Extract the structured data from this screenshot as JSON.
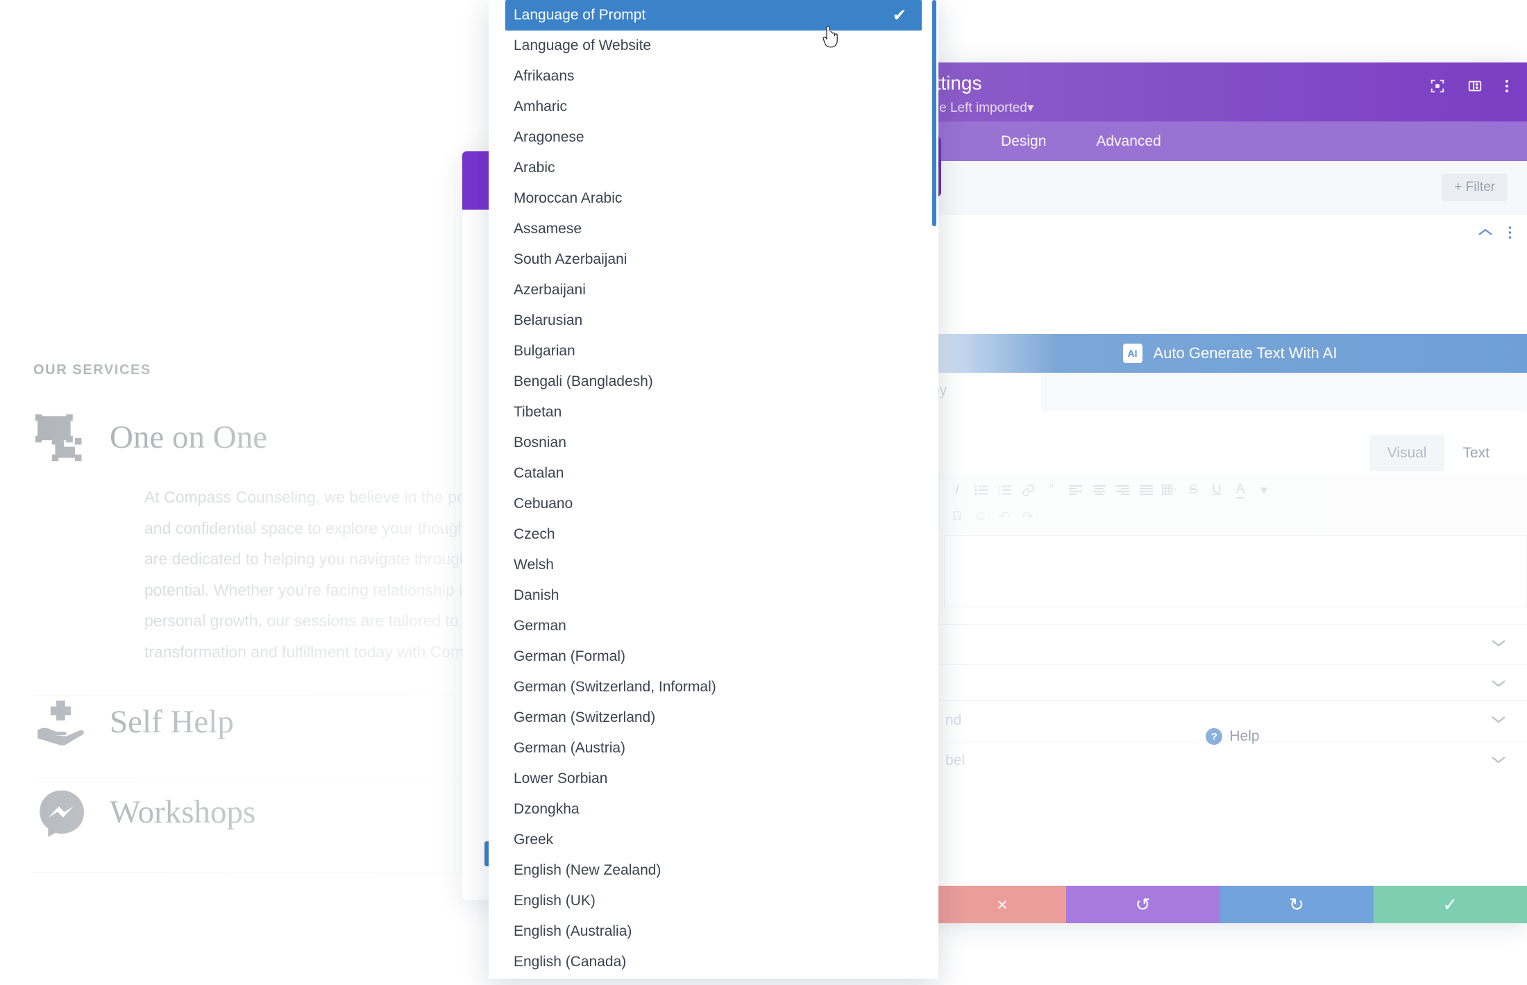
{
  "site_preview": {
    "eyebrow": "OUR SERVICES",
    "services": [
      {
        "icon": "screen-share-icon",
        "title": "One on One",
        "body": "At Compass Counseling, we believe in the power of connection. Our One-on-One sessions provide a safe and confidential space to explore your thoughts, feelings, and challenges. Our experienced counselors are dedicated to helping you navigate through life's ups and downs, empowering you to discover your true potential. Whether you're facing relationship issues, struggling with anxiety or depression, or seeking personal growth, our sessions are tailored to meet your unique needs. Start your journey toward healing, transformation and fulfillment today with Compass Counseling."
      },
      {
        "icon": "helping-hand-icon",
        "title": "Self Help",
        "body": ""
      },
      {
        "icon": "messenger-chat-icon",
        "title": "Workshops",
        "body": ""
      }
    ]
  },
  "hidden_modal": {
    "title": "",
    "primary_button": "",
    "secondary_button": ""
  },
  "divi_panel": {
    "header": {
      "title": "ettings",
      "subtitle": "age Left imported",
      "subtitle_caret": "▾",
      "icons": [
        {
          "name": "fullscreen-icon"
        },
        {
          "name": "split-view-icon"
        },
        {
          "name": "more-options-icon"
        }
      ]
    },
    "tabs": [
      {
        "label": "Design",
        "active": false
      },
      {
        "label": "Advanced",
        "active": false
      }
    ],
    "toolbar": {
      "filter_label": "Filter",
      "filter_plus": "+",
      "back_arrow": "‹"
    },
    "content": {
      "collapse_chevron": "⌃",
      "section_menu": "⋮",
      "ai_button_label": "Auto Generate Text With AI",
      "ai_badge": "AI",
      "field_label_partial": "py",
      "editor_tabs": [
        {
          "label": "Visual",
          "active": false
        },
        {
          "label": "Text",
          "active": true
        }
      ],
      "editor_toolbar_icons": [
        "italic-icon",
        "bulleted-list-icon",
        "numbered-list-icon",
        "link-icon",
        "blockquote-icon",
        "align-left-icon",
        "align-center-icon",
        "align-right-icon",
        "align-justify-icon",
        "table-icon",
        "strikethrough-icon",
        "underline-icon",
        "text-color-icon"
      ],
      "editor_toolbar_icons_row2": [
        "special-character-icon",
        "emoji-icon",
        "undo-icon",
        "redo-icon"
      ],
      "accordions": [
        {
          "label": "",
          "chevron": "⌄"
        },
        {
          "label": "",
          "chevron": "⌄"
        },
        {
          "label": "nd",
          "chevron": "⌄"
        },
        {
          "label": "bel",
          "chevron": "⌄"
        }
      ],
      "help_label": "Help",
      "help_icon": "?"
    },
    "actions": [
      {
        "name": "delete-button",
        "icon": "×",
        "color": "#eb9d9b"
      },
      {
        "name": "undo-button",
        "icon": "↺",
        "color": "#a77ae0"
      },
      {
        "name": "redo-button",
        "icon": "↻",
        "color": "#73a3dc"
      },
      {
        "name": "save-button",
        "icon": "✓",
        "color": "#7ecfb0"
      }
    ]
  },
  "language_dropdown": {
    "selected": "Language of Prompt",
    "check_glyph": "✔",
    "items": [
      "Language of Prompt",
      "Language of Website",
      "Afrikaans",
      "Amharic",
      "Aragonese",
      "Arabic",
      "Moroccan Arabic",
      "Assamese",
      "South Azerbaijani",
      "Azerbaijani",
      "Belarusian",
      "Bulgarian",
      "Bengali (Bangladesh)",
      "Tibetan",
      "Bosnian",
      "Catalan",
      "Cebuano",
      "Czech",
      "Welsh",
      "Danish",
      "German",
      "German (Formal)",
      "German (Switzerland, Informal)",
      "German (Switzerland)",
      "German (Austria)",
      "Lower Sorbian",
      "Dzongkha",
      "Greek",
      "English (New Zealand)",
      "English (UK)",
      "English (Australia)",
      "English (Canada)"
    ]
  },
  "colors": {
    "dropdown_selected": "#3b82c9",
    "divi_header_purple": "#7b3ec4",
    "divi_tabs_purple": "#9a72d4",
    "ai_blue": "#6e9fd6",
    "save_green": "#7ecfb0",
    "delete_red": "#eb9d9b"
  },
  "cursor": {
    "type": "pointer-hand-cursor"
  }
}
